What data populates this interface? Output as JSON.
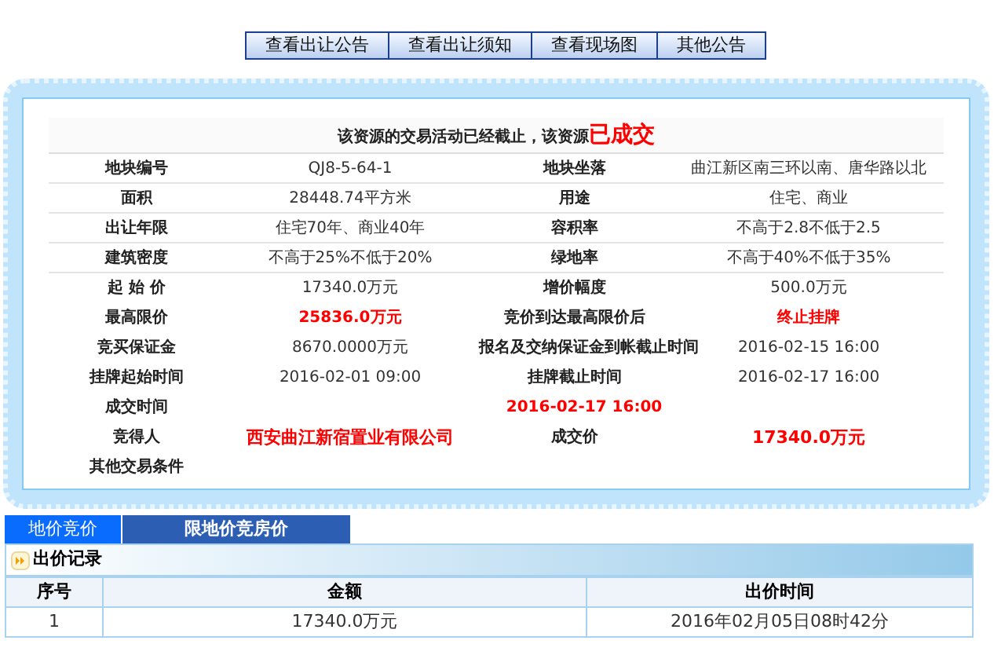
{
  "top_buttons": [
    "查看出让公告",
    "查看出让须知",
    "查看现场图",
    "其他公告"
  ],
  "notice": {
    "text": "该资源的交易活动已经截止，该资源",
    "status": "已成交"
  },
  "rows": [
    {
      "kind": "pair",
      "cells": [
        {
          "kind": "label",
          "text": "地块编号"
        },
        {
          "kind": "value",
          "text": "QJ8-5-64-1"
        },
        {
          "kind": "label",
          "text": "地块坐落"
        },
        {
          "kind": "value",
          "text": "曲江新区南三环以南、唐华路以北"
        }
      ]
    },
    {
      "kind": "pair",
      "cells": [
        {
          "kind": "label",
          "text": "面积"
        },
        {
          "kind": "value",
          "text": "28448.74平方米"
        },
        {
          "kind": "label",
          "text": "用途"
        },
        {
          "kind": "value",
          "text": "住宅、商业"
        }
      ]
    },
    {
      "kind": "pair",
      "cells": [
        {
          "kind": "label",
          "text": "出让年限"
        },
        {
          "kind": "value",
          "text": "住宅70年、商业40年"
        },
        {
          "kind": "label",
          "text": "容积率"
        },
        {
          "kind": "value",
          "text": "不高于2.8不低于2.5"
        }
      ]
    },
    {
      "kind": "pair",
      "cells": [
        {
          "kind": "label",
          "text": "建筑密度"
        },
        {
          "kind": "value",
          "text": "不高于25%不低于20%"
        },
        {
          "kind": "label",
          "text": "绿地率"
        },
        {
          "kind": "value",
          "text": "不高于40%不低于35%"
        }
      ]
    },
    {
      "kind": "pair",
      "cells": [
        {
          "kind": "label",
          "text": "起 始 价"
        },
        {
          "kind": "value",
          "text": "17340.0万元"
        },
        {
          "kind": "label",
          "text": "增价幅度"
        },
        {
          "kind": "value",
          "text": "500.0万元"
        }
      ]
    },
    {
      "kind": "pair",
      "cells": [
        {
          "kind": "label",
          "text": "最高限价"
        },
        {
          "kind": "alert",
          "text": "25836.0万元"
        },
        {
          "kind": "label",
          "text": "竞价到达最高限价后"
        },
        {
          "kind": "alert",
          "text": "终止挂牌"
        }
      ]
    },
    {
      "kind": "pair",
      "cells": [
        {
          "kind": "label",
          "text": "竞买保证金"
        },
        {
          "kind": "value",
          "text": "8670.0000万元"
        },
        {
          "kind": "label",
          "text": "报名及交纳保证金到帐截止时间"
        },
        {
          "kind": "value",
          "text": "2016-02-15 16:00"
        }
      ]
    },
    {
      "kind": "pair",
      "cells": [
        {
          "kind": "label",
          "text": "挂牌起始时间"
        },
        {
          "kind": "value",
          "text": "2016-02-01 09:00"
        },
        {
          "kind": "label",
          "text": "挂牌截止时间"
        },
        {
          "kind": "value",
          "text": "2016-02-17 16:00"
        }
      ]
    },
    {
      "kind": "single",
      "cells": [
        {
          "kind": "label",
          "text": "成交时间"
        },
        {
          "kind": "alert",
          "text": "2016-02-17  16:00"
        }
      ]
    },
    {
      "kind": "pair",
      "cells": [
        {
          "kind": "label",
          "text": "竞得人"
        },
        {
          "kind": "big-alert",
          "text": "西安曲江新宿置业有限公司"
        },
        {
          "kind": "label",
          "text": "成交价"
        },
        {
          "kind": "big-alert",
          "text": "17340.0万元"
        }
      ]
    },
    {
      "kind": "single",
      "cells": [
        {
          "kind": "label",
          "text": "其他交易条件"
        }
      ]
    }
  ],
  "tabs": [
    {
      "label": "地价竞价",
      "selected": false
    },
    {
      "label": "限地价竞房价",
      "selected": true
    }
  ],
  "bid_records": {
    "title": "出价记录",
    "columns": [
      "序号",
      "金额",
      "出价时间"
    ],
    "rows": [
      [
        "1",
        "17340.0万元",
        "2016年02月05日08时42分"
      ]
    ]
  }
}
